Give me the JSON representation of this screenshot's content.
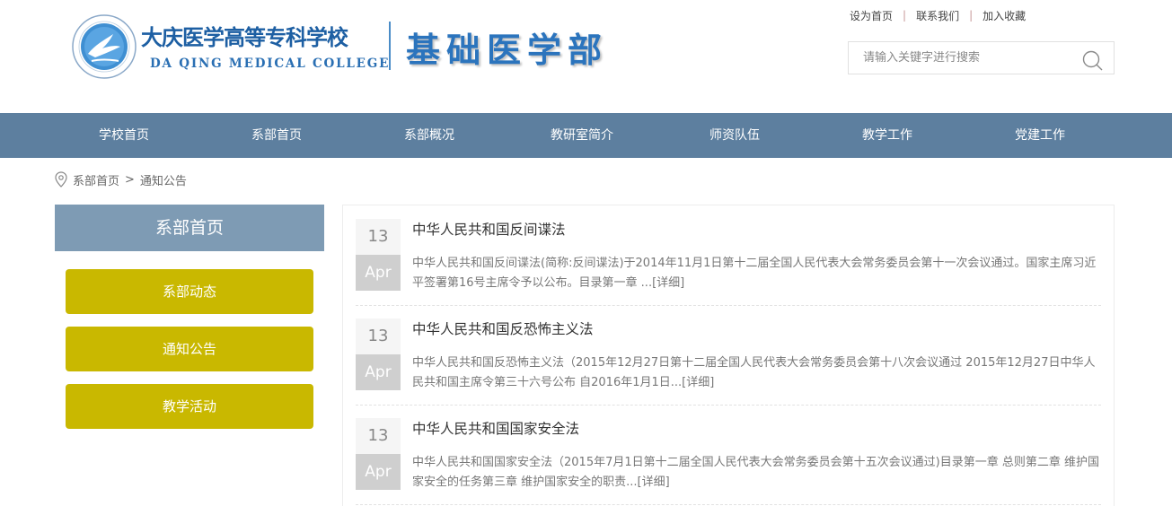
{
  "header": {
    "school_name_cn": "大庆医学高等专科学校",
    "school_name_en": "DA QING MEDICAL COLLEGE",
    "dept_name": "基础医学部",
    "top_links": [
      "设为首页",
      "联系我们",
      "加入收藏"
    ],
    "search_placeholder": "请输入关键字进行搜索"
  },
  "nav": {
    "items": [
      "学校首页",
      "系部首页",
      "系部概况",
      "教研室简介",
      "师资队伍",
      "教学工作",
      "党建工作"
    ]
  },
  "breadcrumb": {
    "home": "系部首页",
    "arrow": ">",
    "current": "通知公告"
  },
  "sidebar": {
    "title": "系部首页",
    "items": [
      "系部动态",
      "通知公告",
      "教学活动"
    ]
  },
  "news": [
    {
      "day": "13",
      "month": "Apr",
      "title": "中华人民共和国反间谍法",
      "summary": "中华人民共和国反间谍法(简称:反间谍法)于2014年11月1日第十二届全国人民代表大会常务委员会第十一次会议通过。国家主席习近平签署第16号主席令予以公布。目录第一章 ...",
      "more": "[详细]"
    },
    {
      "day": "13",
      "month": "Apr",
      "title": "中华人民共和国反恐怖主义法",
      "summary": "中华人民共和国反恐怖主义法（2015年12月27日第十二届全国人民代表大会常务委员会第十八次会议通过 2015年12月27日中华人民共和国主席令第三十六号公布 自2016年1月1日...",
      "more": "[详细]"
    },
    {
      "day": "13",
      "month": "Apr",
      "title": "中华人民共和国国家安全法",
      "summary": "中华人民共和国国家安全法（2015年7月1日第十二届全国人民代表大会常务委员会第十五次会议通过)目录第一章 总则第二章 维护国家安全的任务第三章 维护国家安全的职责...",
      "more": "[详细]"
    }
  ],
  "colors": {
    "nav_bg": "#5d7f9f",
    "sidebar_title_bg": "#7e9bb4",
    "sidebar_btn_bg": "#c9b800",
    "brand_blue": "#2b74bd"
  },
  "icons": {
    "logo": "school-emblem",
    "search": "search-icon",
    "location": "location-pin-icon"
  }
}
